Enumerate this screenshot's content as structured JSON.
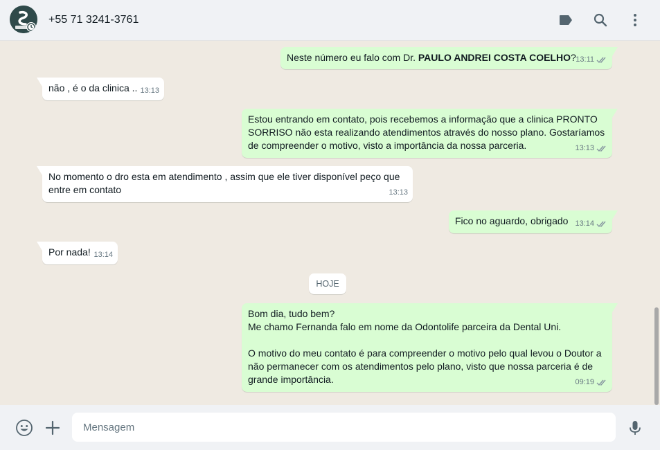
{
  "header": {
    "contact_name": "+55 71 3241-3761",
    "icons": [
      "label-icon",
      "search-icon",
      "menu-icon"
    ]
  },
  "day_divider": "HOJE",
  "messages": [
    {
      "direction": "out",
      "text_pre": "Neste número eu falo com Dr. ",
      "text_bold": "PAULO ANDREI COSTA COELHO",
      "text_post": "?",
      "time": "13:11",
      "status": "read"
    },
    {
      "direction": "in",
      "text": "não , é o da clinica ..",
      "time": "13:13"
    },
    {
      "direction": "out",
      "text": "Estou entrando em contato, pois recebemos a informação que a clinica PRONTO SORRISO não esta realizando atendimentos através do nosso plano. Gostaríamos de compreender o motivo, visto a importância da nossa parceria.",
      "time": "13:13",
      "status": "read"
    },
    {
      "direction": "in",
      "text": "No momento o dro esta em atendimento , assim que ele tiver disponível peço que entre em contato",
      "time": "13:13"
    },
    {
      "direction": "out",
      "text": "Fico no aguardo, obrigado",
      "time": "13:14",
      "status": "read"
    },
    {
      "direction": "in",
      "text": "Por nada!",
      "time": "13:14"
    },
    {
      "direction": "out",
      "text": "Bom dia, tudo bem?\nMe chamo Fernanda falo em nome da Odontolife parceira da Dental Uni.\n\nO motivo do meu contato é para compreender o motivo pelo qual levou o Doutor a não permanecer com os atendimentos pelo plano, visto que nossa parceria é de grande importância.",
      "time": "09:19",
      "status": "read"
    }
  ],
  "composer": {
    "placeholder": "Mensagem",
    "value": "",
    "icons": [
      "emoji-icon",
      "attach-plus-icon",
      "microphone-icon"
    ]
  },
  "colors": {
    "outgoing_bubble": "#d9fdd3",
    "incoming_bubble": "#ffffff",
    "chat_background": "#efeae2",
    "tick_read": "#53bdeb",
    "tick_sent": "#8696a0"
  }
}
